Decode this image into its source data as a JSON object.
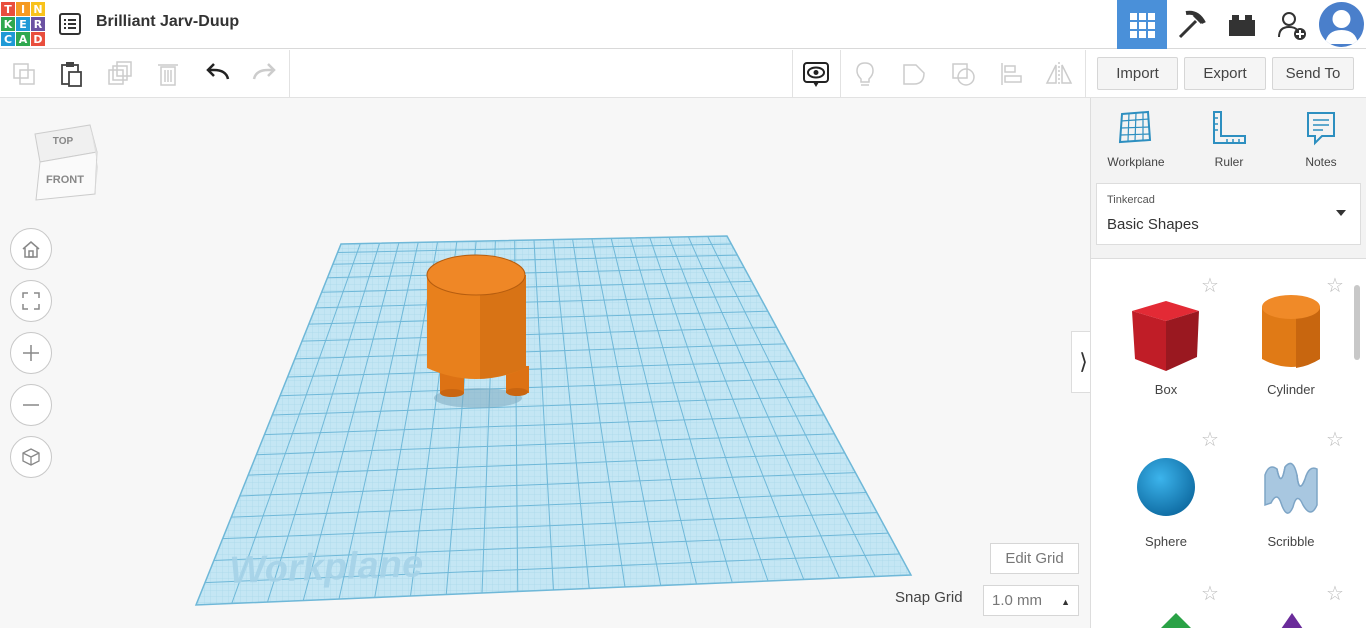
{
  "app": {
    "logo_letters": [
      "T",
      "I",
      "N",
      "K",
      "E",
      "R",
      "C",
      "A",
      "D"
    ],
    "logo_colors": [
      "#e94e3d",
      "#f59a22",
      "#f9c21b",
      "#2fa84f",
      "#1f9ad6",
      "#6c52a2",
      "#1f9ad6",
      "#2fa84f",
      "#e94e3d"
    ],
    "design_title": "Brilliant Jarv-Duup"
  },
  "header_buttons": [
    {
      "name": "3d-design-view-icon",
      "active": true
    },
    {
      "name": "pickaxe-icon",
      "active": false
    },
    {
      "name": "bricks-icon",
      "active": false
    },
    {
      "name": "add-user-icon",
      "active": false
    }
  ],
  "toolbar": {
    "left_icons": [
      "copy-icon",
      "paste-icon",
      "duplicate-icon",
      "delete-icon",
      "undo-icon",
      "redo-icon"
    ],
    "right_icons": [
      "show-all-icon",
      "light-bulb-icon",
      "group-icon",
      "ungroup-icon",
      "align-icon",
      "mirror-icon"
    ],
    "import_label": "Import",
    "export_label": "Export",
    "sendto_label": "Send To"
  },
  "viewcube": {
    "top_label": "TOP",
    "front_label": "FRONT"
  },
  "nav_buttons": [
    "home-view-icon",
    "fit-view-icon",
    "zoom-in-icon",
    "zoom-out-icon",
    "perspective-icon"
  ],
  "workplane": {
    "label": "Workplane",
    "grid_color": "#9fd3e8"
  },
  "canvas": {
    "edit_grid_label": "Edit Grid",
    "snap_grid_label": "Snap Grid",
    "snap_grid_value": "1.0 mm"
  },
  "panel": {
    "tools": [
      {
        "icon": "workplane-icon",
        "label": "Workplane"
      },
      {
        "icon": "ruler-icon",
        "label": "Ruler"
      },
      {
        "icon": "notes-icon",
        "label": "Notes"
      }
    ],
    "library_source": "Tinkercad",
    "library_name": "Basic Shapes",
    "shapes": [
      {
        "label": "Box",
        "color": "#d0222c"
      },
      {
        "label": "Cylinder",
        "color": "#e8801c"
      },
      {
        "label": "Sphere",
        "color": "#1e96d4"
      },
      {
        "label": "Scribble",
        "color": "#a8c7e0"
      }
    ],
    "accent": "#2d8fc0"
  }
}
